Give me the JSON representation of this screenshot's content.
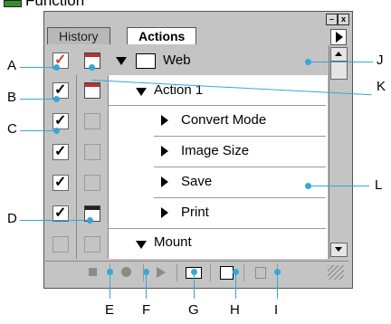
{
  "header": {
    "title": "Function",
    "icon": "folder-icon"
  },
  "window": {
    "minimize_glyph": "–",
    "close_glyph": "x",
    "tabs": [
      {
        "label": "History",
        "active": false
      },
      {
        "label": "Actions",
        "active": true
      }
    ]
  },
  "actions": {
    "set": {
      "label": "Web",
      "expanded": true
    },
    "items": [
      {
        "label": "Action 1",
        "level": 1,
        "expanded": true,
        "checked": true,
        "dialog": "red"
      },
      {
        "label": "Convert Mode",
        "level": 2,
        "expanded": false,
        "checked": true,
        "dialog": "none"
      },
      {
        "label": "Image Size",
        "level": 2,
        "expanded": false,
        "checked": true,
        "dialog": "none"
      },
      {
        "label": "Save",
        "level": 2,
        "expanded": false,
        "checked": true,
        "dialog": "none"
      },
      {
        "label": "Print",
        "level": 2,
        "expanded": false,
        "checked": true,
        "dialog": "black"
      },
      {
        "label": "Mount",
        "level": 1,
        "expanded": true,
        "checked": false,
        "dialog": "none"
      }
    ]
  },
  "bottom_buttons": [
    "stop-icon",
    "record-icon",
    "play-icon",
    "new-set-icon",
    "new-action-icon",
    "delete-icon"
  ],
  "callouts": [
    "A",
    "B",
    "C",
    "D",
    "E",
    "F",
    "G",
    "H",
    "I",
    "J",
    "K",
    "L"
  ],
  "colors": {
    "callout": "#35a7d8",
    "panel": "#c4c4c4"
  }
}
